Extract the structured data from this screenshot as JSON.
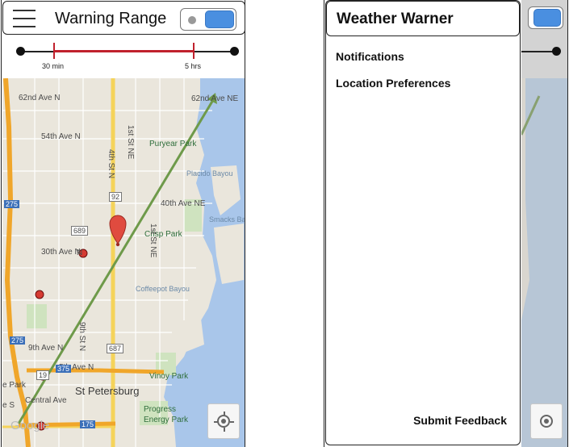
{
  "left_screen": {
    "title": "Warning Range",
    "toggle_on": true,
    "range": {
      "min_label": "30 min",
      "max_label": "5 hrs"
    },
    "map": {
      "labels": {
        "ave62": "62nd Ave N",
        "ave62ne": "62nd Ave NE",
        "ave54": "54th Ave N",
        "puryear": "Puryear Park",
        "placido": "Placido Bayou",
        "ave40ne": "40th Ave NE",
        "smacks": "Smacks Bay",
        "crisp": "Crisp Park",
        "ave30": "30th Ave N",
        "coffeepot": "Coffeepot Bayou",
        "ave9": "9th Ave N",
        "ave5": "5th Ave N",
        "stpete": "St Petersburg",
        "vinoy": "Vinoy Park",
        "progress1": "Progress",
        "progress2": "Energy Park",
        "central": "Central Ave",
        "epark": "e Park",
        "es": "e S",
        "st4n": "4th St N",
        "st1ne_a": "1st St NE",
        "st1ne_b": "1st St NE",
        "st9n": "9th St N",
        "google": "Google",
        "shield92": "92",
        "shield689": "689",
        "shield687": "687",
        "shield275a": "275",
        "shield275b": "275",
        "shield375": "375",
        "shield175": "175",
        "shield19": "19",
        "num_n": "N"
      }
    }
  },
  "right_screen": {
    "title": "Weather Warner",
    "menu": [
      "Notifications",
      "Location Preferences"
    ],
    "feedback": "Submit Feedback"
  },
  "colors": {
    "accent_blue": "#4a8fe0",
    "range_red": "#c0212d",
    "route_green": "#6e9a4a",
    "highway_orange": "#f0a62a",
    "pin_red": "#d63b32"
  }
}
